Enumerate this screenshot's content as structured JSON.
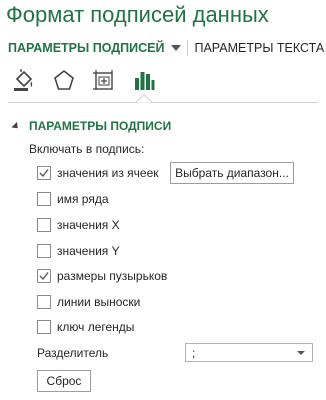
{
  "pane": {
    "title": "Формат подписей данных"
  },
  "tabs": {
    "active": "ПАРАМЕТРЫ ПОДПИСЕЙ",
    "other": "ПАРАМЕТРЫ ТЕКСТА"
  },
  "icons": [
    {
      "name": "fill-line-icon",
      "selected": false
    },
    {
      "name": "effects-pentagon-icon",
      "selected": false
    },
    {
      "name": "size-properties-icon",
      "selected": false
    },
    {
      "name": "label-options-chart-icon",
      "selected": true
    }
  ],
  "section": {
    "title": "ПАРАМЕТРЫ ПОДПИСИ",
    "expanded": true
  },
  "include_label": "Включать в подпись:",
  "options": [
    {
      "label": "значения из ячеек",
      "checked": true
    },
    {
      "label": "имя ряда",
      "checked": false
    },
    {
      "label": "значения X",
      "checked": false
    },
    {
      "label": "значения Y",
      "checked": false
    },
    {
      "label": "размеры пузырьков",
      "checked": true
    },
    {
      "label": "линии выноски",
      "checked": false
    },
    {
      "label": "ключ легенды",
      "checked": false
    }
  ],
  "select_range_button": "Выбрать диапазон...",
  "separator": {
    "label": "Разделитель",
    "value": ";"
  },
  "reset_button": "Сброс",
  "colors": {
    "accent": "#217346",
    "text": "#262626"
  }
}
